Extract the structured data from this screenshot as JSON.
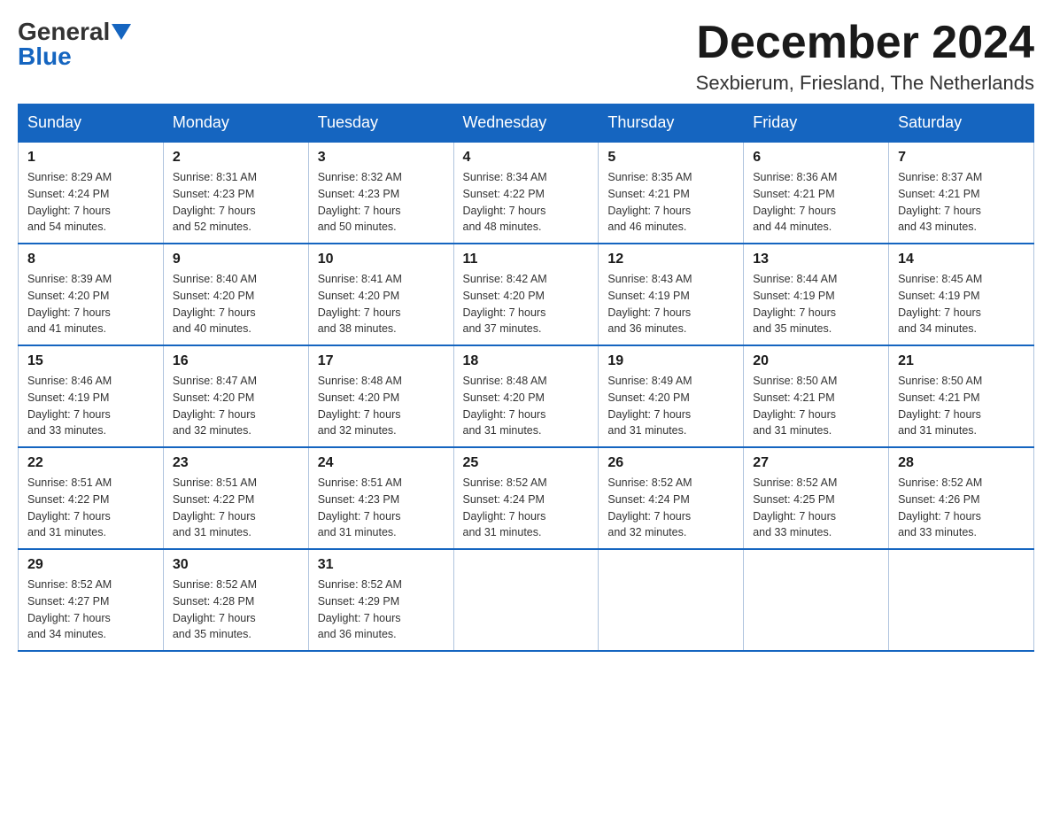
{
  "header": {
    "logo_general": "General",
    "logo_blue": "Blue",
    "month_title": "December 2024",
    "location": "Sexbierum, Friesland, The Netherlands"
  },
  "weekdays": [
    "Sunday",
    "Monday",
    "Tuesday",
    "Wednesday",
    "Thursday",
    "Friday",
    "Saturday"
  ],
  "weeks": [
    [
      {
        "day": "1",
        "sunrise": "8:29 AM",
        "sunset": "4:24 PM",
        "daylight": "7 hours and 54 minutes."
      },
      {
        "day": "2",
        "sunrise": "8:31 AM",
        "sunset": "4:23 PM",
        "daylight": "7 hours and 52 minutes."
      },
      {
        "day": "3",
        "sunrise": "8:32 AM",
        "sunset": "4:23 PM",
        "daylight": "7 hours and 50 minutes."
      },
      {
        "day": "4",
        "sunrise": "8:34 AM",
        "sunset": "4:22 PM",
        "daylight": "7 hours and 48 minutes."
      },
      {
        "day": "5",
        "sunrise": "8:35 AM",
        "sunset": "4:21 PM",
        "daylight": "7 hours and 46 minutes."
      },
      {
        "day": "6",
        "sunrise": "8:36 AM",
        "sunset": "4:21 PM",
        "daylight": "7 hours and 44 minutes."
      },
      {
        "day": "7",
        "sunrise": "8:37 AM",
        "sunset": "4:21 PM",
        "daylight": "7 hours and 43 minutes."
      }
    ],
    [
      {
        "day": "8",
        "sunrise": "8:39 AM",
        "sunset": "4:20 PM",
        "daylight": "7 hours and 41 minutes."
      },
      {
        "day": "9",
        "sunrise": "8:40 AM",
        "sunset": "4:20 PM",
        "daylight": "7 hours and 40 minutes."
      },
      {
        "day": "10",
        "sunrise": "8:41 AM",
        "sunset": "4:20 PM",
        "daylight": "7 hours and 38 minutes."
      },
      {
        "day": "11",
        "sunrise": "8:42 AM",
        "sunset": "4:20 PM",
        "daylight": "7 hours and 37 minutes."
      },
      {
        "day": "12",
        "sunrise": "8:43 AM",
        "sunset": "4:19 PM",
        "daylight": "7 hours and 36 minutes."
      },
      {
        "day": "13",
        "sunrise": "8:44 AM",
        "sunset": "4:19 PM",
        "daylight": "7 hours and 35 minutes."
      },
      {
        "day": "14",
        "sunrise": "8:45 AM",
        "sunset": "4:19 PM",
        "daylight": "7 hours and 34 minutes."
      }
    ],
    [
      {
        "day": "15",
        "sunrise": "8:46 AM",
        "sunset": "4:19 PM",
        "daylight": "7 hours and 33 minutes."
      },
      {
        "day": "16",
        "sunrise": "8:47 AM",
        "sunset": "4:20 PM",
        "daylight": "7 hours and 32 minutes."
      },
      {
        "day": "17",
        "sunrise": "8:48 AM",
        "sunset": "4:20 PM",
        "daylight": "7 hours and 32 minutes."
      },
      {
        "day": "18",
        "sunrise": "8:48 AM",
        "sunset": "4:20 PM",
        "daylight": "7 hours and 31 minutes."
      },
      {
        "day": "19",
        "sunrise": "8:49 AM",
        "sunset": "4:20 PM",
        "daylight": "7 hours and 31 minutes."
      },
      {
        "day": "20",
        "sunrise": "8:50 AM",
        "sunset": "4:21 PM",
        "daylight": "7 hours and 31 minutes."
      },
      {
        "day": "21",
        "sunrise": "8:50 AM",
        "sunset": "4:21 PM",
        "daylight": "7 hours and 31 minutes."
      }
    ],
    [
      {
        "day": "22",
        "sunrise": "8:51 AM",
        "sunset": "4:22 PM",
        "daylight": "7 hours and 31 minutes."
      },
      {
        "day": "23",
        "sunrise": "8:51 AM",
        "sunset": "4:22 PM",
        "daylight": "7 hours and 31 minutes."
      },
      {
        "day": "24",
        "sunrise": "8:51 AM",
        "sunset": "4:23 PM",
        "daylight": "7 hours and 31 minutes."
      },
      {
        "day": "25",
        "sunrise": "8:52 AM",
        "sunset": "4:24 PM",
        "daylight": "7 hours and 31 minutes."
      },
      {
        "day": "26",
        "sunrise": "8:52 AM",
        "sunset": "4:24 PM",
        "daylight": "7 hours and 32 minutes."
      },
      {
        "day": "27",
        "sunrise": "8:52 AM",
        "sunset": "4:25 PM",
        "daylight": "7 hours and 33 minutes."
      },
      {
        "day": "28",
        "sunrise": "8:52 AM",
        "sunset": "4:26 PM",
        "daylight": "7 hours and 33 minutes."
      }
    ],
    [
      {
        "day": "29",
        "sunrise": "8:52 AM",
        "sunset": "4:27 PM",
        "daylight": "7 hours and 34 minutes."
      },
      {
        "day": "30",
        "sunrise": "8:52 AM",
        "sunset": "4:28 PM",
        "daylight": "7 hours and 35 minutes."
      },
      {
        "day": "31",
        "sunrise": "8:52 AM",
        "sunset": "4:29 PM",
        "daylight": "7 hours and 36 minutes."
      },
      null,
      null,
      null,
      null
    ]
  ],
  "labels": {
    "sunrise": "Sunrise:",
    "sunset": "Sunset:",
    "daylight": "Daylight:"
  }
}
